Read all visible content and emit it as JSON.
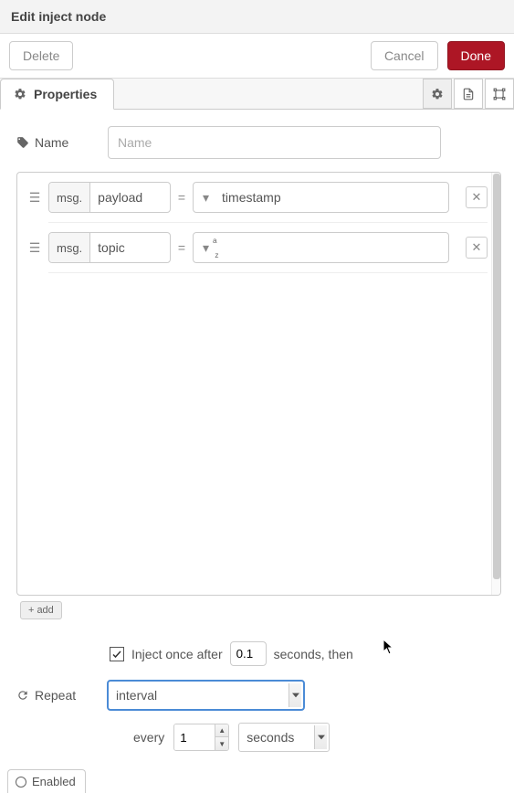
{
  "header": {
    "title": "Edit inject node"
  },
  "buttons": {
    "delete": "Delete",
    "cancel": "Cancel",
    "done": "Done"
  },
  "tabs": {
    "properties": "Properties"
  },
  "name": {
    "label": "Name",
    "placeholder": "Name",
    "value": ""
  },
  "props": [
    {
      "prefix": "msg.",
      "field": "payload",
      "typeLabel": "timestamp",
      "typeIcon": "caret",
      "value": ""
    },
    {
      "prefix": "msg.",
      "field": "topic",
      "typeLabel": "",
      "typeIcon": "az",
      "value": ""
    }
  ],
  "add_button": "add",
  "inject": {
    "checked": true,
    "label_before": "Inject once after",
    "delay": "0.1",
    "label_after": "seconds, then"
  },
  "repeat": {
    "label": "Repeat",
    "mode": "interval",
    "every_label": "every",
    "every_value": "1",
    "unit": "seconds"
  },
  "enabled": {
    "label": "Enabled"
  }
}
